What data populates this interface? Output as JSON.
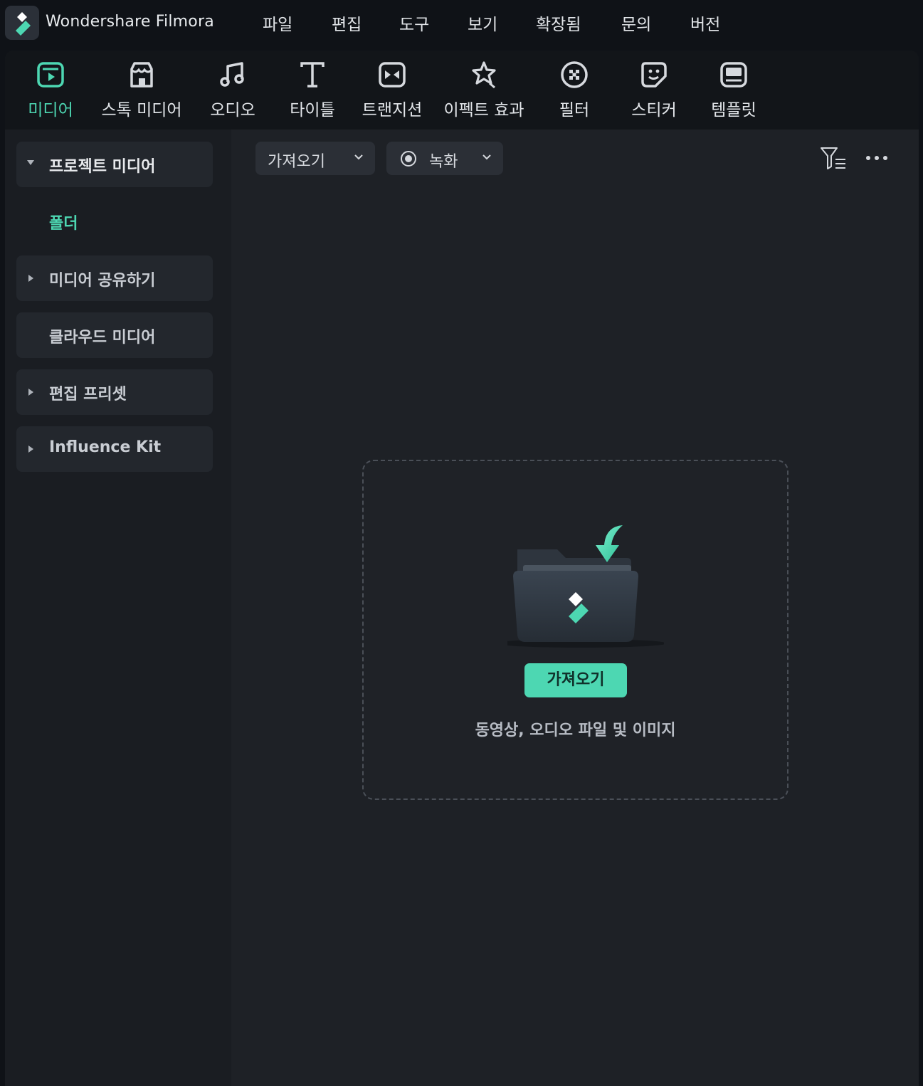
{
  "app": {
    "name": "Wondershare Filmora",
    "logo_icon": "filmora-logo-icon"
  },
  "menu": [
    {
      "id": "file",
      "label": "파일"
    },
    {
      "id": "edit",
      "label": "편집"
    },
    {
      "id": "tools",
      "label": "도구"
    },
    {
      "id": "view",
      "label": "보기"
    },
    {
      "id": "extensions",
      "label": "확장됨"
    },
    {
      "id": "help",
      "label": "문의"
    },
    {
      "id": "version",
      "label": "버전"
    }
  ],
  "tabs": [
    {
      "id": "media",
      "label": "미디어",
      "icon": "media-icon",
      "active": true
    },
    {
      "id": "stock",
      "label": "스톡 미디어",
      "icon": "stock-store-icon"
    },
    {
      "id": "audio",
      "label": "오디오",
      "icon": "music-note-icon"
    },
    {
      "id": "titles",
      "label": "타이틀",
      "icon": "title-t-icon"
    },
    {
      "id": "transitions",
      "label": "트랜지션",
      "icon": "transition-icon"
    },
    {
      "id": "effects",
      "label": "이펙트 효과",
      "icon": "effects-star-icon"
    },
    {
      "id": "filters",
      "label": "필터",
      "icon": "filter-icon"
    },
    {
      "id": "stickers",
      "label": "스티커",
      "icon": "sticker-icon"
    },
    {
      "id": "templates",
      "label": "템플릿",
      "icon": "template-icon"
    }
  ],
  "sidebar": {
    "items": [
      {
        "id": "project-media",
        "label": "프로젝트 미디어",
        "expanded": true,
        "caret": "down"
      },
      {
        "id": "shared-media",
        "label": "미디어 공유하기",
        "caret": "right"
      },
      {
        "id": "cloud-media",
        "label": "클라우드 미디어",
        "caret": "none"
      },
      {
        "id": "edit-presets",
        "label": "편집 프리셋",
        "caret": "right"
      },
      {
        "id": "influence-kit",
        "label": "Influence Kit",
        "caret": "right"
      }
    ],
    "folder_label": "폴더"
  },
  "toolbar": {
    "import_label": "가져오기",
    "record_label": "녹화",
    "filter_icon": "filter-sort-icon",
    "more_icon": "more-dots-icon"
  },
  "dropzone": {
    "button_label": "가져오기",
    "hint": "동영상, 오디오 파일 및 이미지",
    "illustration": "import-folder-icon"
  },
  "colors": {
    "accent": "#4dd7b2",
    "background": "#0f1217",
    "panel": "#1a1d22",
    "content": "#1e2126"
  }
}
